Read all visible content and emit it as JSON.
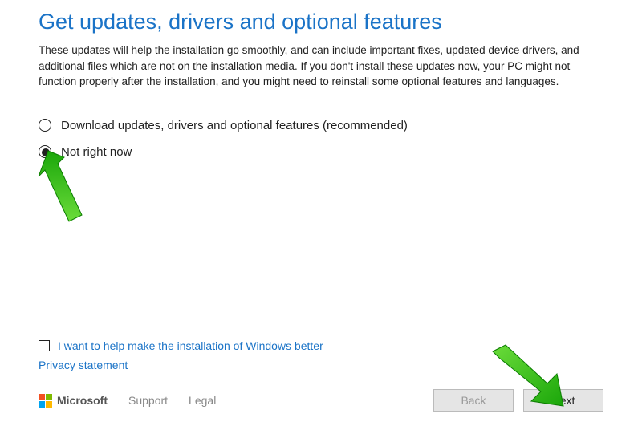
{
  "title": "Get updates, drivers and optional features",
  "description": "These updates will help the installation go smoothly, and can include important fixes, updated device drivers, and additional files which are not on the installation media. If you don't install these updates now, your PC might not function properly after the installation, and you might need to reinstall some optional features and languages.",
  "options": {
    "download": {
      "label": "Download updates, drivers and optional features (recommended)"
    },
    "not_now": {
      "label": "Not right now"
    }
  },
  "help_checkbox_label": "I want to help make the installation of Windows better",
  "privacy_label": "Privacy statement",
  "footer": {
    "brand": "Microsoft",
    "support": "Support",
    "legal": "Legal"
  },
  "buttons": {
    "back": "Back",
    "next": "Next"
  }
}
